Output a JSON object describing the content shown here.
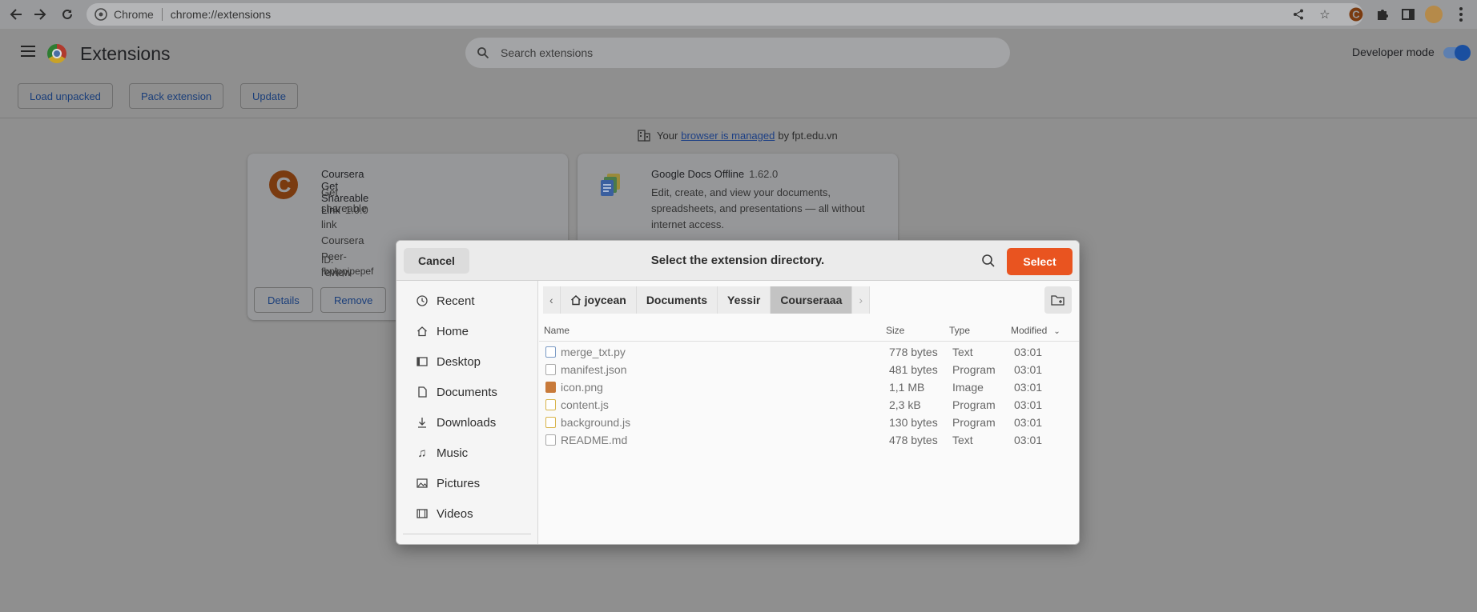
{
  "browser": {
    "site_label": "Chrome",
    "url": "chrome://extensions",
    "toolbar_icons": [
      "back-icon",
      "forward-icon",
      "reload-icon",
      "share-icon",
      "star-icon",
      "coursera-ext-icon",
      "puzzle-icon",
      "sidepanel-icon",
      "avatar",
      "more-icon"
    ]
  },
  "header": {
    "title": "Extensions",
    "search_placeholder": "Search extensions",
    "dev_mode_label": "Developer mode",
    "dev_mode_on": true,
    "buttons": {
      "load_unpacked": "Load unpacked",
      "pack_extension": "Pack extension",
      "update": "Update"
    }
  },
  "managed": {
    "prefix": "Your",
    "link": "browser is managed",
    "suffix": "by fpt.edu.vn"
  },
  "extensions": [
    {
      "name": "Coursera Get Shareable Link",
      "version": "1.0.0",
      "description": "Get shareable link Coursera Peer-review",
      "id_text": "ID: fbplppipepef",
      "details_label": "Details",
      "remove_label": "Remove"
    },
    {
      "name": "Google Docs Offline",
      "version": "1.62.0",
      "description_lines": [
        "Edit, create, and view your documents,",
        "spreadsheets, and presentations — all without",
        "internet access."
      ]
    }
  ],
  "dialog": {
    "title": "Select the extension directory.",
    "cancel_label": "Cancel",
    "select_label": "Select",
    "places": [
      "Recent",
      "Home",
      "Desktop",
      "Documents",
      "Downloads",
      "Music",
      "Pictures",
      "Videos"
    ],
    "path": [
      "joycean",
      "Documents",
      "Yessir",
      "Courseraaa"
    ],
    "columns": {
      "name": "Name",
      "size": "Size",
      "type": "Type",
      "modified": "Modified"
    },
    "files": [
      {
        "name": "merge_txt.py",
        "size": "778 bytes",
        "type": "Text",
        "modified": "03:01"
      },
      {
        "name": "manifest.json",
        "size": "481 bytes",
        "type": "Program",
        "modified": "03:01"
      },
      {
        "name": "icon.png",
        "size": "1,1 MB",
        "type": "Image",
        "modified": "03:01"
      },
      {
        "name": "content.js",
        "size": "2,3 kB",
        "type": "Program",
        "modified": "03:01"
      },
      {
        "name": "background.js",
        "size": "130 bytes",
        "type": "Program",
        "modified": "03:01"
      },
      {
        "name": "README.md",
        "size": "478 bytes",
        "type": "Text",
        "modified": "03:01"
      }
    ]
  },
  "colors": {
    "accent_select": "#e95420",
    "overlay_page": "#8f8f8f",
    "dialog_bg": "#fafafa"
  }
}
